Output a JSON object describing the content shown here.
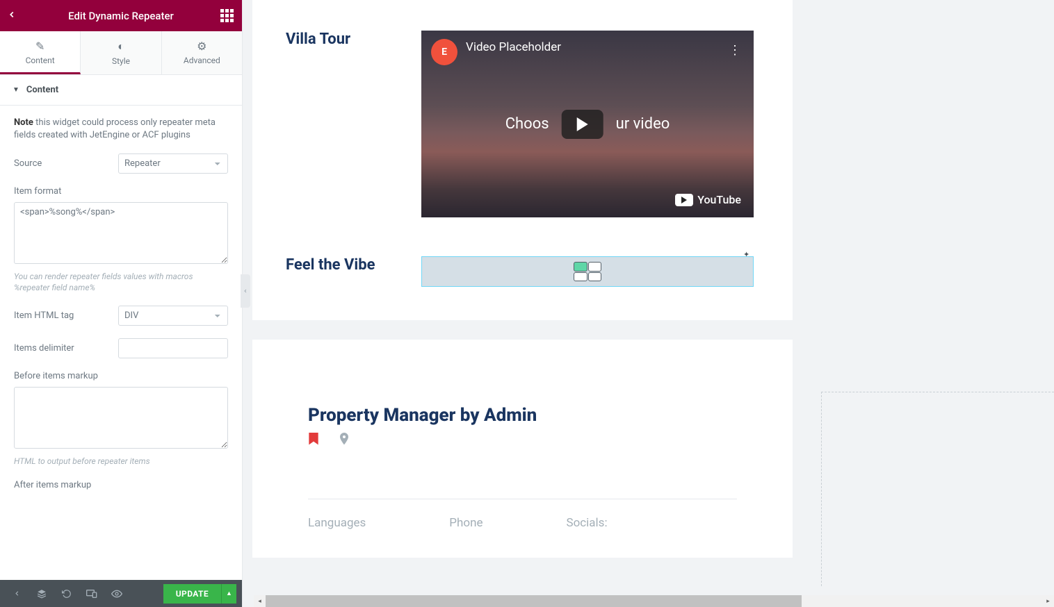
{
  "sidebar": {
    "header_title": "Edit Dynamic Repeater",
    "tabs": {
      "content": "Content",
      "style": "Style",
      "advanced": "Advanced"
    },
    "section_title": "Content",
    "note_bold": "Note",
    "note_text": " this widget could process only repeater meta fields created with JetEngine or ACF plugins",
    "source_label": "Source",
    "source_value": "Repeater",
    "item_format_label": "Item format",
    "item_format_value": "<span>%song%</span>",
    "item_format_help": "You can render repeater fields values with macros %repeater field name%",
    "item_html_tag_label": "Item HTML tag",
    "item_html_tag_value": "DIV",
    "items_delimiter_label": "Items delimiter",
    "items_delimiter_value": "",
    "before_markup_label": "Before items markup",
    "before_markup_value": "",
    "before_markup_help": "HTML to output before repeater items",
    "after_markup_label": "After items markup",
    "update_button": "UPDATE"
  },
  "preview": {
    "villa_title": "Villa Tour",
    "video_title": "Video Placeholder",
    "video_brand": "E",
    "video_center_left": "Choos",
    "video_center_right": "ur video",
    "youtube_label": "YouTube",
    "vibe_title": "Feel the Vibe",
    "manager_title": "Property Manager by Admin",
    "info_languages": "Languages",
    "info_phone": "Phone",
    "info_socials": "Socials:"
  }
}
